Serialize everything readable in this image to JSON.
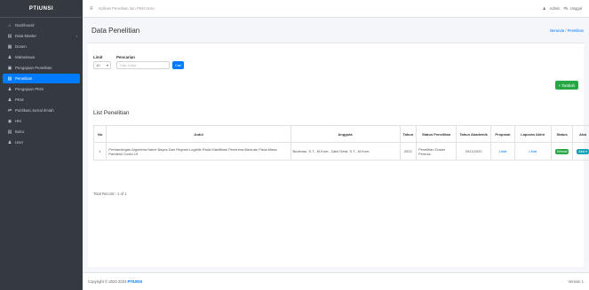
{
  "brand": "PTIUNSI",
  "sidebar": {
    "items": [
      {
        "icon": "⌂",
        "icon_name": "dashboard-icon",
        "label": "Dashboard"
      },
      {
        "icon": "▤",
        "icon_name": "database-icon",
        "label": "Data Master",
        "caret": "‹"
      },
      {
        "icon": "▦",
        "icon_name": "group-icon",
        "label": "Dosen"
      },
      {
        "icon": "♟",
        "icon_name": "student-icon",
        "label": "Mahasiswa"
      },
      {
        "icon": "▣",
        "icon_name": "book-icon",
        "label": "Pengajuan Penelitian"
      },
      {
        "icon": "▤",
        "icon_name": "research-icon",
        "label": "Penelitian",
        "active": true
      },
      {
        "icon": "♟",
        "icon_name": "user-icon",
        "label": "Pengajuan PKM"
      },
      {
        "icon": "♟",
        "icon_name": "pkm-icon",
        "label": "PKM"
      },
      {
        "icon": "⇄",
        "icon_name": "publication-icon",
        "label": "Publikasi Jurnal Ilmiah"
      },
      {
        "icon": "◉",
        "icon_name": "hki-icon",
        "label": "HKI"
      },
      {
        "icon": "▤",
        "icon_name": "book-icon",
        "label": "Buku"
      },
      {
        "icon": "♟",
        "icon_name": "user-icon",
        "label": "User"
      }
    ]
  },
  "topbar": {
    "title": "Aplikasi Penelitian dan PKM Unsri",
    "user_label": "Admin",
    "user_name": "Pk. Unggul"
  },
  "page": {
    "title": "Data Penelitian",
    "breadcrumb_home": "Beranda",
    "breadcrumb_sep": "/",
    "breadcrumb_current": "Penelitian"
  },
  "filter": {
    "label_limit": "Limit",
    "label_search": "Pencarian",
    "limit_value": "10",
    "search_placeholder": "Cari Judul",
    "search_button": "Cari",
    "add_button": "+ Tambah"
  },
  "list": {
    "title": "List Penelitian",
    "headers": [
      "No",
      "Judul",
      "Anggota",
      "Tahun",
      "Status Penelitian",
      "Tahun Akademik",
      "Proposal",
      "Laporan Akhir",
      "Status",
      "Aksi"
    ],
    "rows": [
      {
        "no": "1.",
        "judul": "Perbandingan Algoritma Naive Bayes Dan Regresi Logistik Pada Klasifikasi Penerima Bantuan Pada Masa Pandemi Covid-19",
        "anggota": "Budiman, S.T., M.Kom., Zaini Dewi, S.T., M.Kom.",
        "tahun": "2022",
        "status_penelitian": "Penelitian Dosen Pemula",
        "tahun_akademik": "2021/2022",
        "proposal": "Lihat",
        "laporan": "Lihat",
        "status": "Selesai",
        "aksi": "Aksi ▾"
      }
    ]
  },
  "total": "Total Record : 1 of 1",
  "footer": {
    "copyright": "Copyright © 2022-2023",
    "brand": "PTIUNSI",
    "version": "Version 1"
  }
}
